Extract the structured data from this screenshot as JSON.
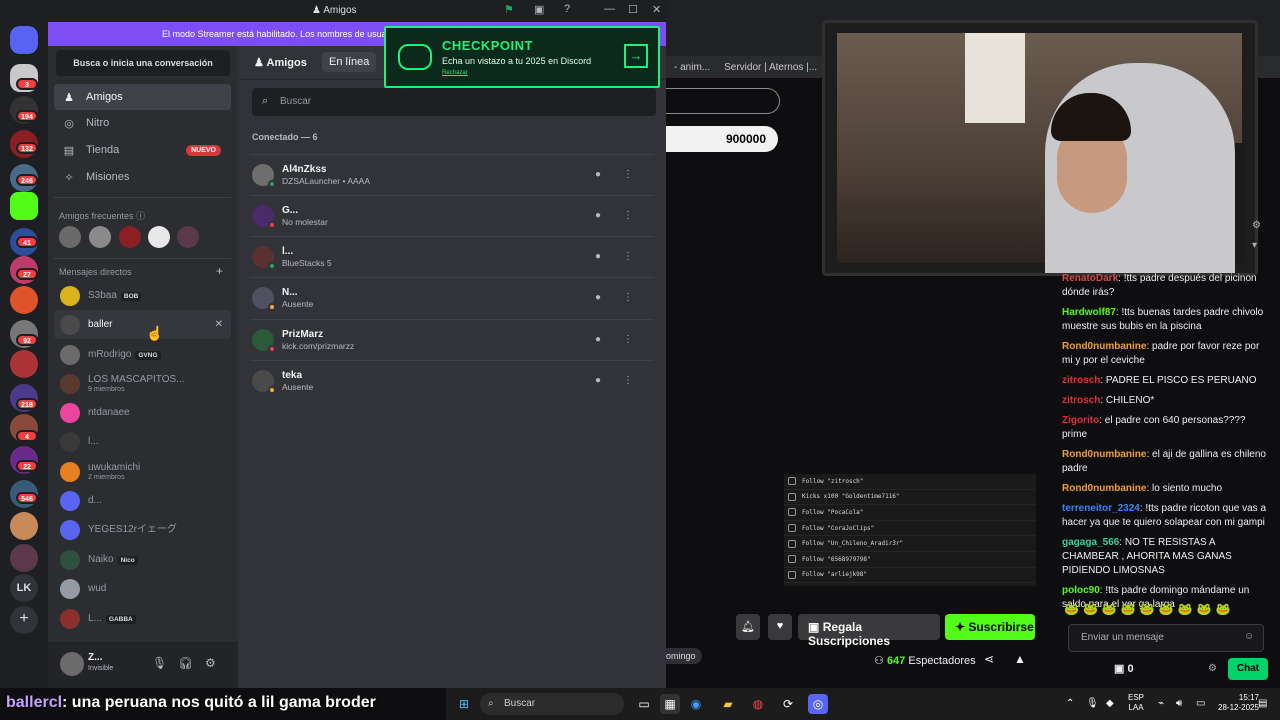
{
  "discord": {
    "window_title": "Amigos",
    "streamer_banner": "El modo Streamer está habilitado. Los nombres de usua",
    "rail_badges": [
      "3",
      "194",
      "132",
      "246",
      "41",
      "27",
      "92",
      "218",
      "4",
      "22",
      "546"
    ],
    "rail_lk_label": "LK",
    "dm_search": "Busca o inicia una conversación",
    "nav": [
      {
        "label": "Amigos",
        "icon": "friends-icon"
      },
      {
        "label": "Nitro",
        "icon": "nitro-icon"
      },
      {
        "label": "Tienda",
        "icon": "shop-icon",
        "badge": "NUEVO"
      },
      {
        "label": "Misiones",
        "icon": "quests-icon"
      }
    ],
    "frequent_friends_label": "Amigos frecuentes",
    "direct_messages_label": "Mensajes directos",
    "dms": [
      {
        "name": "S3baa",
        "tag": "BOB",
        "color": "#d9b21c"
      },
      {
        "name": "baller",
        "color": "#4a4a4a"
      },
      {
        "name": "mRodrigo",
        "tag": "GVNG",
        "color": "#6b6b6b"
      },
      {
        "name": "LOS MASCAPITOS...",
        "sub": "9 miembros",
        "color": "#5b3a2e"
      },
      {
        "name": "ntdanaee",
        "color": "#eb459e"
      },
      {
        "name": "l...",
        "color": "#3a3a3a"
      },
      {
        "name": "uwukamichi",
        "sub": "2 miembros",
        "color": "#e67e22"
      },
      {
        "name": "d...",
        "color": "#5865f2"
      },
      {
        "name": "YEGES12rイェーグ",
        "color": "#5865f2"
      },
      {
        "name": "Naiko",
        "tag": "Nico",
        "color": "#2f4f3f"
      },
      {
        "name": "wud",
        "color": "#949ba4"
      },
      {
        "name": "L...",
        "tag": "GABBA",
        "color": "#8b2e2e"
      }
    ],
    "user_panel": {
      "name": "Z...",
      "status": "Invisible"
    },
    "friends": {
      "header_title": "Amigos",
      "tab_online": "En línea",
      "search_placeholder": "Buscar",
      "online_count": "Conectado — 6",
      "list": [
        {
          "name": "Al4nZkss",
          "status": "DZSALauncher • AAAA",
          "presence": "#23a55a",
          "color": "#6e6e6e"
        },
        {
          "name": "G...",
          "status": "No molestar",
          "presence": "#f23f43",
          "color": "#4a2a6a"
        },
        {
          "name": "l...",
          "status": "BlueStacks 5",
          "presence": "#23a55a",
          "color": "#5a3030"
        },
        {
          "name": "N...",
          "status": "Ausente",
          "presence": "#f0b232",
          "color": "#505060"
        },
        {
          "name": "PrizMarz",
          "status": "kick.com/prizmarzz",
          "presence": "#f23f43",
          "color": "#2a5a3a"
        },
        {
          "name": "teka",
          "status": "Ausente",
          "presence": "#f0b232",
          "color": "#4a4a4a"
        }
      ]
    },
    "checkpoint": {
      "title": "CHECKPOINT",
      "subtitle": "Echa un vistazo a tu 2025 en Discord",
      "dismiss": "Rechazar"
    }
  },
  "stream": {
    "bookmarks": [
      "- anim...",
      "Servidor | Aternos |..."
    ],
    "score": "900000",
    "chat": [
      {
        "user": "RenatoDark",
        "color": "#d14b4b",
        "text": "!tts padre después del picinon dónde irás?"
      },
      {
        "user": "Hardwolf87",
        "color": "#53fc18",
        "text": "!tts buenas tardes padre chivolo muestre sus bubis en la piscina"
      },
      {
        "user": "Rond0numbanine",
        "color": "#f0a030",
        "text": "padre por favor reze por mi y por el ceviche"
      },
      {
        "user": "zitrosch",
        "color": "#e0303a",
        "text": "PADRE EL PISCO ES PERUANO"
      },
      {
        "user": "zitrosch",
        "color": "#e0303a",
        "text": "CHILENO*"
      },
      {
        "user": "Zigorito",
        "color": "#e0303a",
        "text": "el padre con 640 personas???? prime"
      },
      {
        "user": "Rond0numbanine",
        "color": "#f0a030",
        "text": "el aji de gallina es chileno padre"
      },
      {
        "user": "Rond0numbanine",
        "color": "#f0a030",
        "text": "lo siento mucho"
      },
      {
        "user": "terreneitor_2324",
        "color": "#3b82f6",
        "text": "!tts padre ricoton que vas a hacer ya que te quiero solapear con mi gampi"
      },
      {
        "user": "gagaga_566",
        "color": "#34d399",
        "text": "NO TE RESISTAS A CHAMBEAR , AHORITA MAS GANAS PIDIENDO LIMOSNAS"
      },
      {
        "user": "poloc90",
        "color": "#53fc18",
        "text": "!tts padre domingo mándame un saldo para el ver ga larga"
      }
    ],
    "chat_input_placeholder": "Enviar un mensaje",
    "chat_points": "0",
    "chat_button": "Chat",
    "follows": [
      "Follow \"zitrosch\"",
      "Kicks x100 \"Goldentime7116\"",
      "Follow \"PocaCola\"",
      "Follow \"CoraJoClips\"",
      "Follow \"Un_Chileno_Aradir3r\"",
      "Follow \"6568979798\"",
      "Follow \"arliejk98\""
    ],
    "gift_button": "Regala Suscripciones",
    "subscribe_button": "Suscribirse",
    "viewers_count": "647",
    "viewers_label": "Espectadores",
    "tag_pill": "omingo"
  },
  "caption": {
    "user": "ballercl",
    "text": ": una peruana nos quitó a lil gama broder"
  },
  "taskbar": {
    "search_placeholder": "Buscar",
    "lang_top": "ESP",
    "lang_bottom": "LAA",
    "time": "15:17",
    "date": "28-12-2025"
  }
}
